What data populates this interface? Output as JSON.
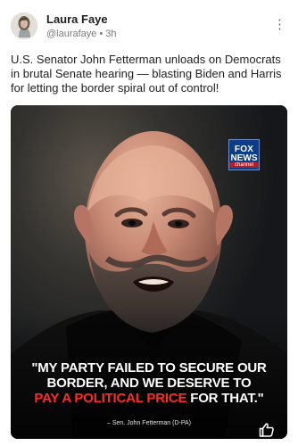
{
  "post": {
    "author": {
      "name": "Laura Faye",
      "handle": "@laurafaye",
      "separator": "•",
      "time": "3h"
    },
    "more_icon": "more-vertical-icon",
    "text": "U.S. Senator John Fetterman unloads on Democrats in brutal Senate hearing — blasting Biden and Harris for letting the border spiral out of control!",
    "media": {
      "logo": {
        "line1": "FOX",
        "line2": "NEWS",
        "line3": "channel"
      },
      "quote": {
        "line1": "\"MY PARTY FAILED TO SECURE OUR",
        "line2": "BORDER, AND WE DESERVE TO",
        "line3_red": "PAY A POLITICAL PRICE",
        "line3_rest": " FOR THAT.\""
      },
      "credit": "– Sen. John Fetterman (D-PA)"
    },
    "reaction_icon": "thumbs-up-icon"
  },
  "colors": {
    "text": "#222222",
    "meta": "#7b7b7b",
    "quote_red": "#ff2c24",
    "fox_blue": "#0d3c88",
    "fox_red": "#b01f2a"
  }
}
